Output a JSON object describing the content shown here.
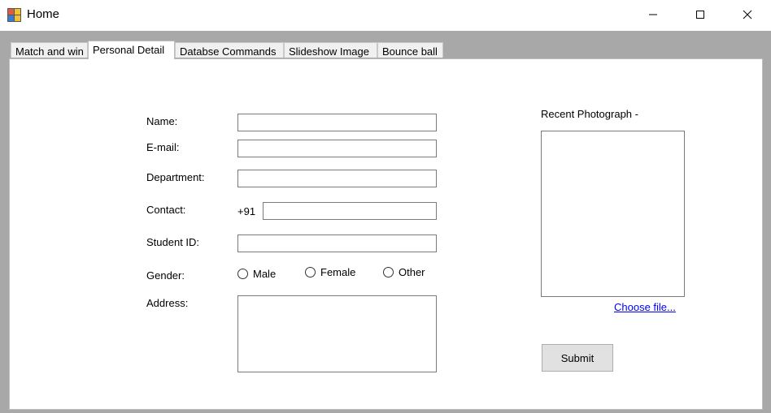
{
  "window": {
    "title": "Home",
    "icon": "winforms-app-icon",
    "controls": [
      "minimize-icon",
      "maximize-icon",
      "close-icon"
    ]
  },
  "tabs": [
    {
      "label": "Match and win",
      "active": false
    },
    {
      "label": "Personal Detail",
      "active": true
    },
    {
      "label": "Databse Commands",
      "active": false
    },
    {
      "label": "Slideshow Image",
      "active": false
    },
    {
      "label": "Bounce ball",
      "active": false
    }
  ],
  "form": {
    "name_label": "Name:",
    "name_value": "",
    "email_label": "E-mail:",
    "email_value": "",
    "department_label": "Department:",
    "department_value": "",
    "contact_label": "Contact:",
    "contact_prefix": "+91",
    "contact_value": "",
    "student_id_label": "Student ID:",
    "student_id_value": "",
    "gender_label": "Gender:",
    "gender_options": [
      "Male",
      "Female",
      "Other"
    ],
    "address_label": "Address:",
    "address_value": ""
  },
  "photo": {
    "label": "Recent Photograph -",
    "choose_link": "Choose file..."
  },
  "submit_label": "Submit",
  "colors": {
    "tab_strip_bg": "#a8a8a8",
    "link": "#0000ff",
    "button_bg": "#e1e1e1"
  }
}
